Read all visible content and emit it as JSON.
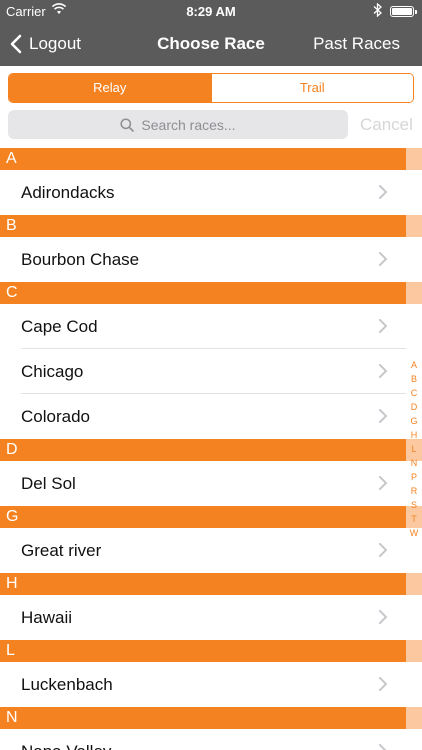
{
  "status": {
    "carrier": "Carrier",
    "time": "8:29 AM"
  },
  "nav": {
    "back_label": "Logout",
    "title": "Choose Race",
    "right_label": "Past Races"
  },
  "segments": [
    "Relay",
    "Trail"
  ],
  "search": {
    "placeholder": "Search races...",
    "cancel_label": "Cancel"
  },
  "sections": [
    {
      "letter": "A",
      "items": [
        "Adirondacks"
      ]
    },
    {
      "letter": "B",
      "items": [
        "Bourbon Chase"
      ]
    },
    {
      "letter": "C",
      "items": [
        "Cape Cod",
        "Chicago",
        "Colorado"
      ]
    },
    {
      "letter": "D",
      "items": [
        "Del Sol"
      ]
    },
    {
      "letter": "G",
      "items": [
        "Great river"
      ]
    },
    {
      "letter": "H",
      "items": [
        "Hawaii"
      ]
    },
    {
      "letter": "L",
      "items": [
        "Luckenbach"
      ]
    },
    {
      "letter": "N",
      "items": [
        "Napa Valley"
      ]
    }
  ],
  "index": [
    "A",
    "B",
    "C",
    "D",
    "G",
    "H",
    "L",
    "N",
    "P",
    "R",
    "S",
    "T",
    "W"
  ],
  "colors": {
    "accent": "#f58220",
    "navbar": "#5b5b5b"
  }
}
